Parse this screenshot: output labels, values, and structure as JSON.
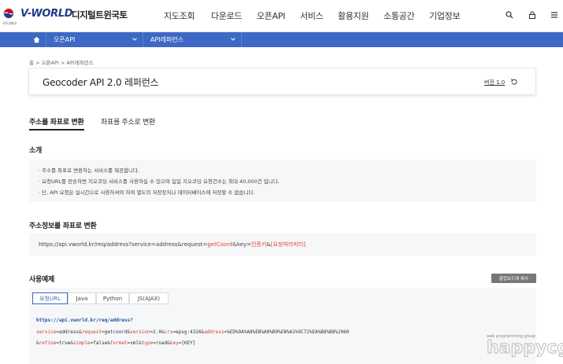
{
  "header": {
    "emblem_text": "국토교통부",
    "brand": "V-WORLD",
    "brand_sub": "디지털트윈국토",
    "nav": [
      "지도조회",
      "다운로드",
      "오픈API",
      "서비스",
      "활용지원",
      "소통공간",
      "기업정보"
    ],
    "icons": [
      "search-icon",
      "lock-icon",
      "menu-icon"
    ]
  },
  "subnav": {
    "home_icon": "home-icon",
    "select1": "오픈API",
    "select2": "API레퍼런스"
  },
  "breadcrumb": [
    "홈",
    "오픈API",
    "API레퍼런스"
  ],
  "title_card": {
    "title": "Geocoder API 2.0 레퍼런스",
    "version": "버전 1.0"
  },
  "tabs": {
    "active": "주소를 좌표로 변환",
    "inactive": "좌표를 주소로 변환"
  },
  "intro": {
    "title": "소개",
    "lines": [
      "· 주소를 좌표로 변환하는 서비스를 제공합니다.",
      "· 요청URL를 전송하면 지오코딩 서비스를 사용하실 수 있으며 일일 지오코딩 요청건수는 최대 40,000건 입니다.",
      "· 단, API 요청은 실시간으로 사용하셔야 하며 별도의 저장장치나 데이터베이스에 저장할 수 없습니다."
    ]
  },
  "endpoint": {
    "title": "주소정보를 좌표로 변환",
    "url_prefix": "https://api.vworld.kr/req/address?service=address&request=",
    "url_get": "getCoord",
    "url_mid": "&key=",
    "url_key": "인증키",
    "url_amp": "&",
    "url_params": "[요청파라미터]"
  },
  "example": {
    "title": "사용예제",
    "copy_label": "클립보드에 복사",
    "tabs": [
      "요청URL",
      "Java",
      "Python",
      "JS(AJAX)"
    ],
    "active_tab": "요청URL",
    "code_url": "https://api.vworld.kr/req/address?",
    "line2": [
      {
        "t": "service",
        "c": "r"
      },
      {
        "t": "=address&",
        "c": "p"
      },
      {
        "t": "request",
        "c": "r"
      },
      {
        "t": "=getcoord&",
        "c": "p"
      },
      {
        "t": "version",
        "c": "r"
      },
      {
        "t": "=2.0&",
        "c": "p"
      },
      {
        "t": "crs",
        "c": "r"
      },
      {
        "t": "=epsg:4326&",
        "c": "p"
      },
      {
        "t": "address",
        "c": "r"
      },
      {
        "t": "=%ED%9A%A8%EB%A0%B9%EB%A1%9C72%EA%B8%B8%2060",
        "c": "p"
      }
    ],
    "line3": [
      {
        "t": "&",
        "c": "p"
      },
      {
        "t": "refine",
        "c": "r"
      },
      {
        "t": "=true&",
        "c": "p"
      },
      {
        "t": "simple",
        "c": "r"
      },
      {
        "t": "=false&",
        "c": "p"
      },
      {
        "t": "format",
        "c": "r"
      },
      {
        "t": "=xml&",
        "c": "p"
      },
      {
        "t": "type",
        "c": "r"
      },
      {
        "t": "=road&",
        "c": "p"
      },
      {
        "t": "key",
        "c": "r"
      },
      {
        "t": "=[KEY]",
        "c": "p"
      }
    ]
  },
  "watermark": {
    "small": "web programming group",
    "big": "happycgi"
  },
  "colors": {
    "accent": "#3d68c5",
    "red": "#e0442e",
    "box_bg": "#f6f7f9"
  }
}
